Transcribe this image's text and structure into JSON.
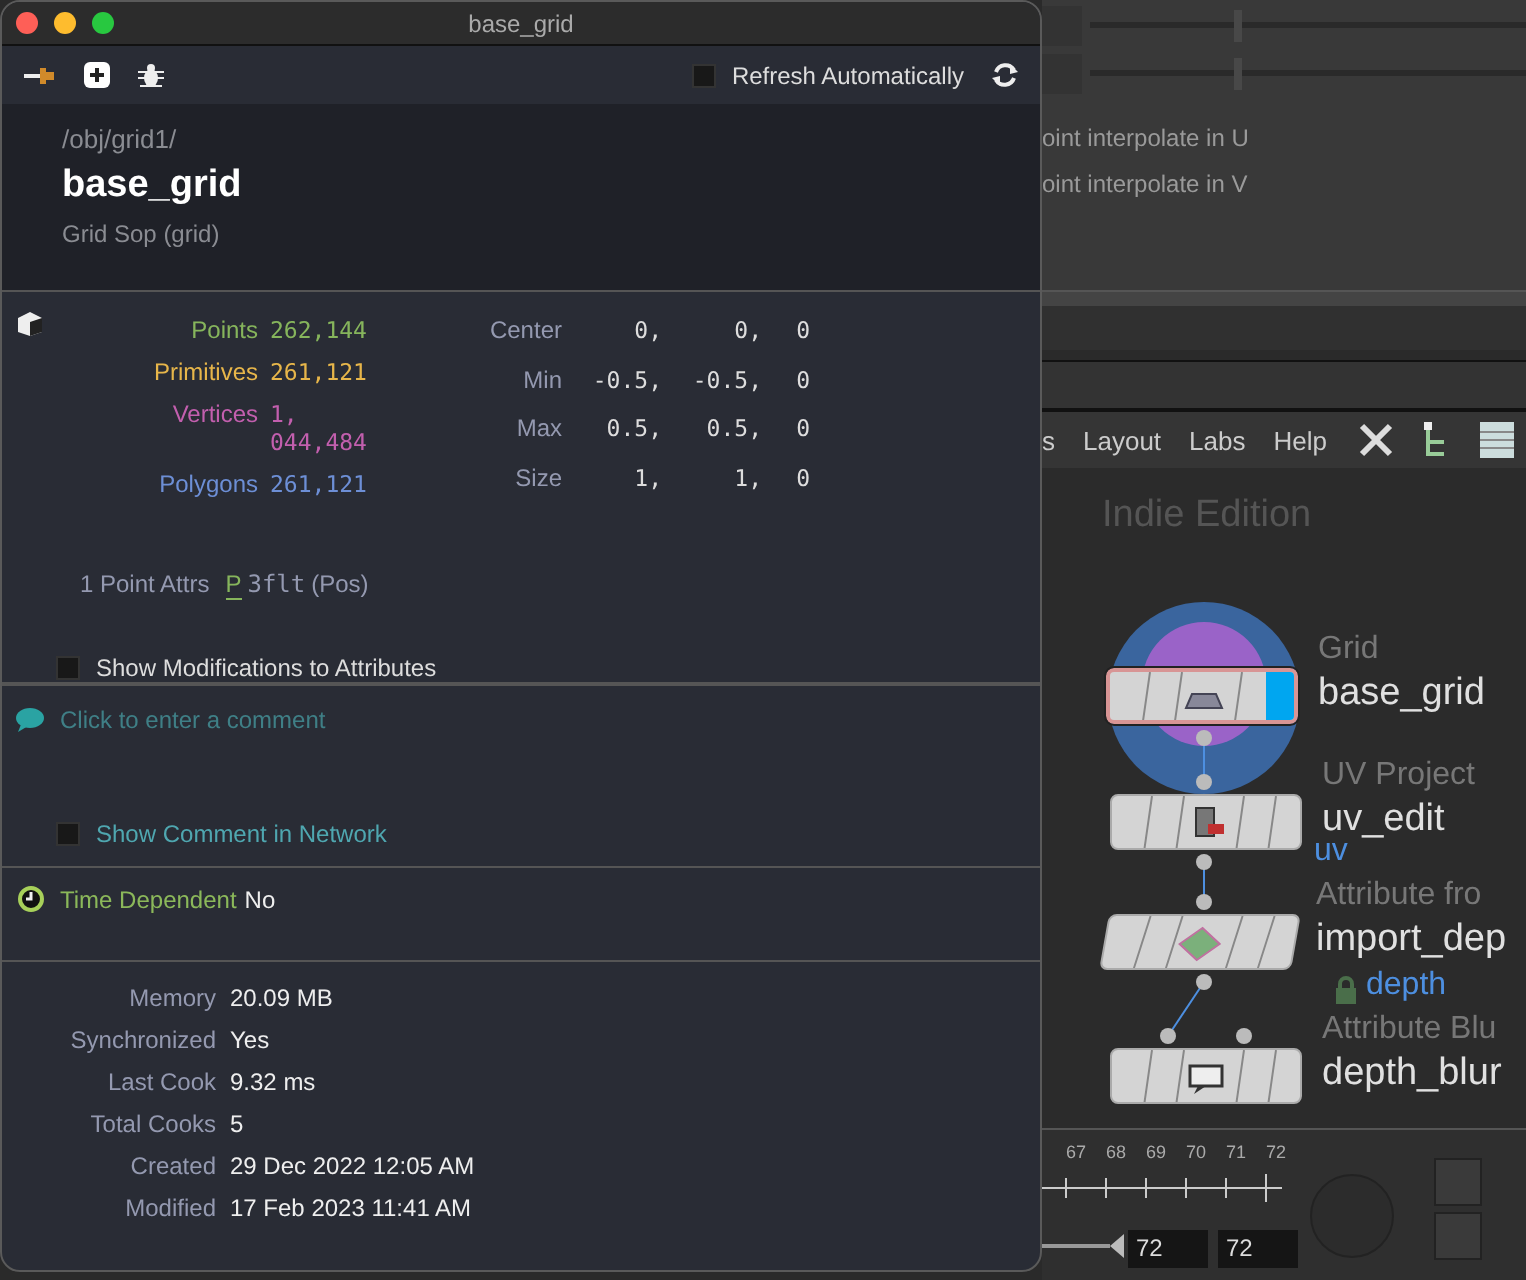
{
  "window": {
    "title": "base_grid"
  },
  "toolbar": {
    "refresh": {
      "label": "Refresh Automatically",
      "checked": false
    }
  },
  "header": {
    "path": "/obj/grid1/",
    "name": "base_grid",
    "type": "Grid Sop (grid)"
  },
  "geometry": {
    "counts": [
      {
        "label": "Points",
        "value": "262,144",
        "color": "#86b55c"
      },
      {
        "label": "Primitives",
        "value": "261,121",
        "color": "#e7b64a"
      },
      {
        "label": "Vertices",
        "value": "1,044,484",
        "color": "#c25fae"
      },
      {
        "label": "Polygons",
        "value": "261,121",
        "color": "#6d8fd6"
      }
    ],
    "bounds": [
      {
        "label": "Center",
        "values": [
          "0,",
          "0,",
          "0"
        ]
      },
      {
        "label": "Min",
        "values": [
          "-0.5,",
          "-0.5,",
          "0"
        ]
      },
      {
        "label": "Max",
        "values": [
          "0.5,",
          "0.5,",
          "0"
        ]
      },
      {
        "label": "Size",
        "values": [
          "1,",
          "1,",
          "0"
        ]
      }
    ],
    "attrs": {
      "label": "1 Point Attrs",
      "name": "P",
      "type": "3flt",
      "info": "(Pos)"
    },
    "show_modifications": {
      "label": "Show Modifications to Attributes",
      "checked": false
    }
  },
  "comment": {
    "placeholder": "Click to enter a comment",
    "show_in_network": {
      "label": "Show Comment in Network",
      "checked": false
    }
  },
  "time_dependent": {
    "label": "Time Dependent",
    "value": "No"
  },
  "stats": [
    {
      "label": "Memory",
      "value": "20.09 MB"
    },
    {
      "label": "Synchronized",
      "value": "Yes"
    },
    {
      "label": "Last Cook",
      "value": "9.32 ms"
    },
    {
      "label": "Total Cooks",
      "value": "5"
    },
    {
      "label": "Created",
      "value": "29 Dec 2022 12:05 AM"
    },
    {
      "label": "Modified",
      "value": "17 Feb 2023 11:41 AM"
    }
  ],
  "background": {
    "sliders": [
      {
        "level": 0.33
      },
      {
        "level": 0.33
      }
    ],
    "param_labels": [
      "oint interpolate in U",
      "oint interpolate in V"
    ],
    "menu": [
      "s",
      "Layout",
      "Labs",
      "Help"
    ],
    "watermark": "Indie Edition",
    "nodes": [
      {
        "kind": "box",
        "type": "Grid",
        "name": "base_grid",
        "selected": true,
        "display": true
      },
      {
        "kind": "box",
        "type": "UV Project",
        "name": "uv_edit",
        "selected": false,
        "display": false
      },
      {
        "kind": "slanted",
        "type": "Attribute fro",
        "name": "import_dep",
        "wire_label": "uv",
        "selected": false,
        "display": false
      },
      {
        "kind": "box",
        "type": "Attribute Blu",
        "name": "depth_blur",
        "wire_label": "depth",
        "selected": false,
        "display": false
      }
    ],
    "timeline": {
      "ticks": [
        "67",
        "68",
        "69",
        "70",
        "71",
        "72"
      ],
      "start": "72",
      "end": "72"
    }
  }
}
